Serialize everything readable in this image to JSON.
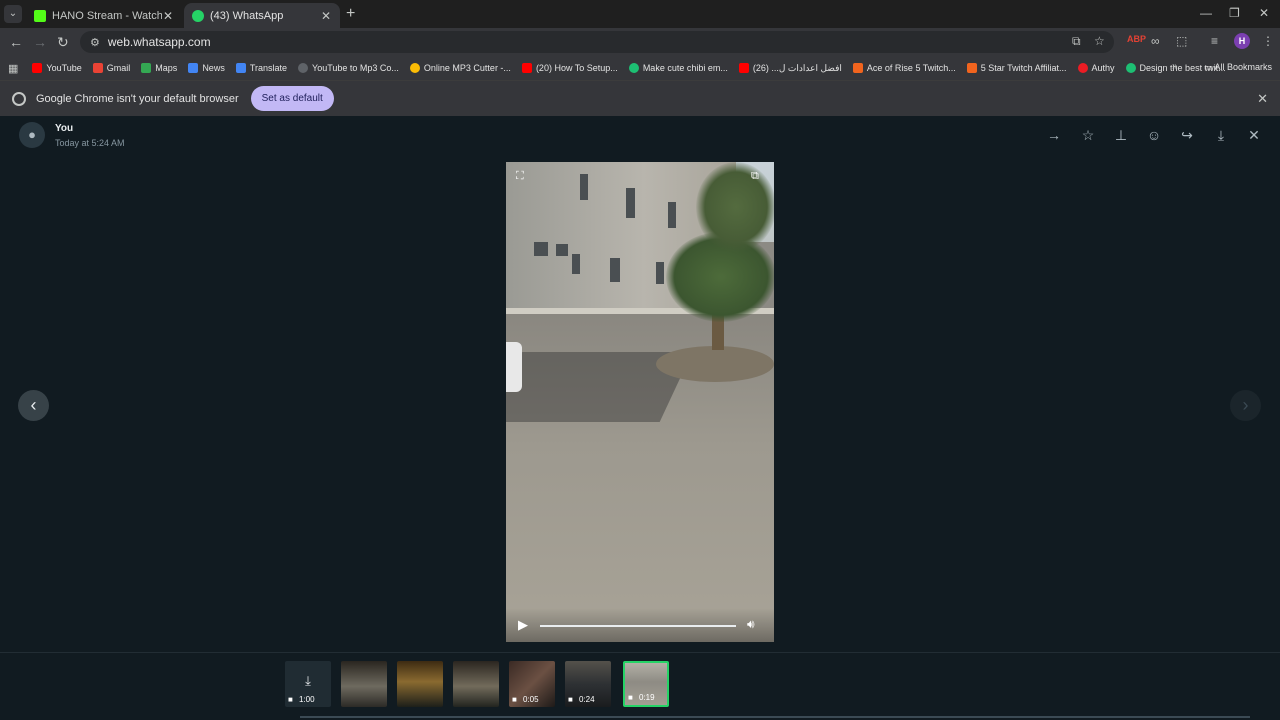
{
  "browser": {
    "tabs": [
      {
        "title": "HANO Stream - Watch Live on",
        "favicon_color": "#53fc18"
      },
      {
        "title": "(43) WhatsApp",
        "favicon_color": "#25d366"
      }
    ],
    "url": "web.whatsapp.com",
    "bookmarks": [
      {
        "label": "YouTube",
        "color": "#ff0000"
      },
      {
        "label": "Gmail",
        "color": "#ea4335"
      },
      {
        "label": "Maps",
        "color": "#34a853"
      },
      {
        "label": "News",
        "color": "#4285f4"
      },
      {
        "label": "Translate",
        "color": "#4285f4"
      },
      {
        "label": "YouTube to Mp3 Co...",
        "color": "#5f6368"
      },
      {
        "label": "Online MP3 Cutter -...",
        "color": "#fbbc05"
      },
      {
        "label": "(20) How To Setup...",
        "color": "#ff0000"
      },
      {
        "label": "Make cute chibi em...",
        "color": "#1dbf73"
      },
      {
        "label": "افضل اعدادات ل... (26)",
        "color": "#ff0000"
      },
      {
        "label": "Ace of Rise 5 Twitch...",
        "color": "#f1641e"
      },
      {
        "label": "5 Star Twitch Affiliat...",
        "color": "#f1641e"
      },
      {
        "label": "Authy",
        "color": "#ec1c24"
      },
      {
        "label": "Design the best twit...",
        "color": "#1dbf73"
      }
    ],
    "all_bookmarks": "All Bookmarks",
    "infobar": {
      "message": "Google Chrome isn't your default browser",
      "button": "Set as default"
    },
    "profile_initial": "H"
  },
  "viewer": {
    "sender": "You",
    "timestamp": "Today at 5:24 AM",
    "header_icons": [
      "arrow-right-icon",
      "star-icon",
      "pin-icon",
      "emoji-icon",
      "forward-icon",
      "download-icon",
      "close-icon"
    ],
    "thumbnails": [
      {
        "type": "download",
        "duration": "1:00"
      },
      {
        "type": "image",
        "duration": ""
      },
      {
        "type": "image",
        "duration": ""
      },
      {
        "type": "image",
        "duration": ""
      },
      {
        "type": "video",
        "duration": "0:05"
      },
      {
        "type": "video",
        "duration": "0:24"
      },
      {
        "type": "video",
        "duration": "0:19",
        "selected": true
      }
    ]
  },
  "colors": {
    "accent": "#25d366",
    "background": "#111b21",
    "infobar_button": "#c2b8f5"
  }
}
